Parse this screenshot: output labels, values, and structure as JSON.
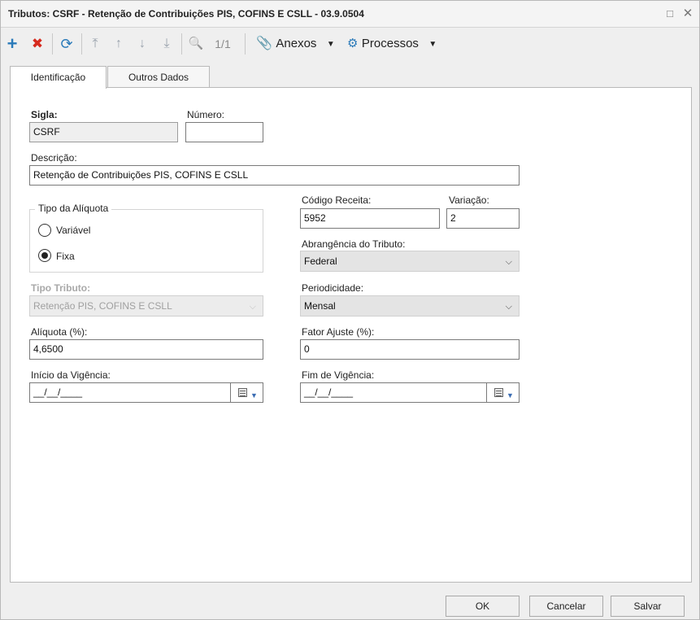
{
  "window": {
    "title": "Tributos: CSRF - Retenção de Contribuições PIS, COFINS E CSLL - 03.9.0504",
    "maximize_icon": "□",
    "close_icon": "✕"
  },
  "toolbar": {
    "add_icon": "+",
    "delete_icon": "✖",
    "refresh_icon": "⟳",
    "first_icon": "⤒",
    "prev_icon": "↑",
    "next_icon": "↓",
    "last_icon": "⤓",
    "search_icon": "🔍",
    "record_position": "1/1",
    "anexos_label": "Anexos",
    "processos_label": "Processos",
    "dropdown_caret": "▼",
    "colors": {
      "add": "#2a7ab9",
      "delete": "#d62a1e",
      "nav": "#3a86c8",
      "disabled_nav": "#9aa3ad"
    }
  },
  "tabs": [
    {
      "label": "Identificação",
      "active": true
    },
    {
      "label": "Outros Dados",
      "active": false
    }
  ],
  "form": {
    "sigla_label": "Sigla:",
    "sigla_value": "CSRF",
    "numero_label": "Número:",
    "numero_value": "",
    "descricao_label": "Descrição:",
    "descricao_value": "Retenção de Contribuições PIS, COFINS E CSLL",
    "tipo_aliquota_legend": "Tipo da Alíquota",
    "radio_variavel": "Variável",
    "radio_fixa": "Fixa",
    "radio_selected": "Fixa",
    "codigo_receita_label": "Código Receita:",
    "codigo_receita_value": "5952",
    "variacao_label": "Variação:",
    "variacao_value": "2",
    "abrangencia_label": "Abrangência do Tributo:",
    "abrangencia_value": "Federal",
    "tipo_tributo_label": "Tipo Tributo:",
    "tipo_tributo_value": "Retenção PIS, COFINS E CSLL",
    "periodicidade_label": "Periodicidade:",
    "periodicidade_value": "Mensal",
    "aliquota_label": "Alíquota (%):",
    "aliquota_value": "4,6500",
    "fator_ajuste_label": "Fator Ajuste (%):",
    "fator_ajuste_value": "0",
    "inicio_vigencia_label": "Início da Vigência:",
    "inicio_vigencia_value": "__/__/____",
    "fim_vigencia_label": "Fim de Vigência:",
    "fim_vigencia_value": "__/__/____",
    "select_chevron": "⌵"
  },
  "footer": {
    "ok_label": "OK",
    "cancel_label": "Cancelar",
    "save_label": "Salvar"
  }
}
